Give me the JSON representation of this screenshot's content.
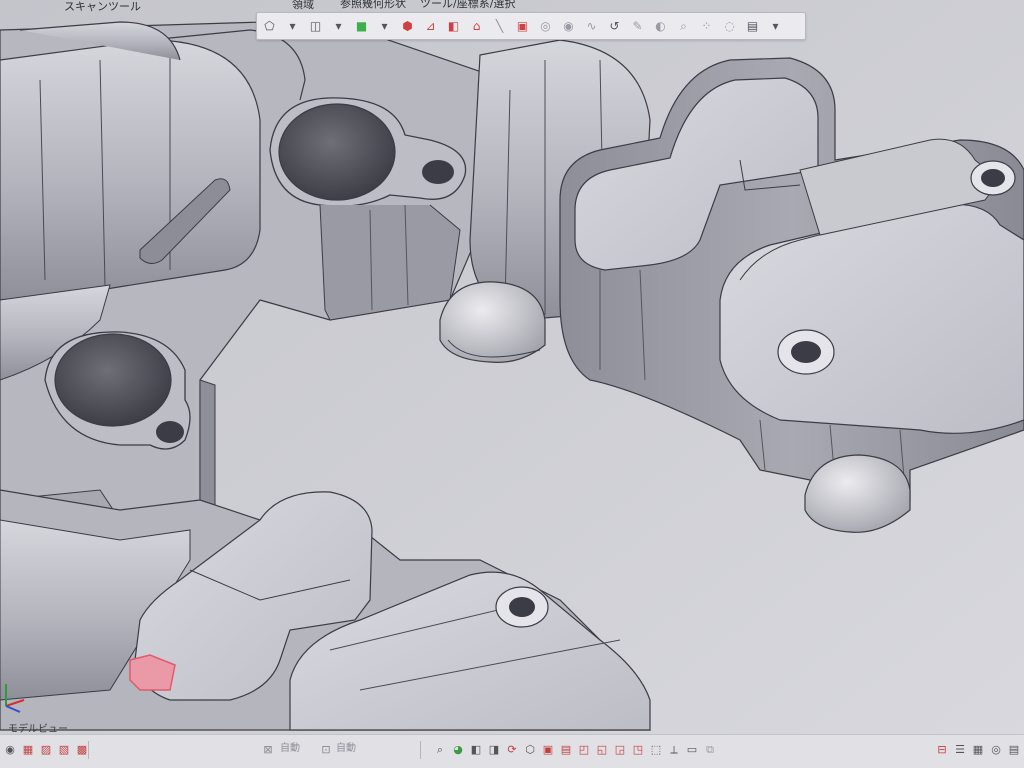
{
  "ribbon": {
    "tab_scan_tools": "スキャンツール",
    "group_area": "領域",
    "group_reference": "参照幾何形状",
    "group_tools": "ツール/座標系/選択"
  },
  "toolbar": {
    "icons": [
      {
        "name": "shape-tool-icon",
        "glyph": "⬠",
        "color": "#555560"
      },
      {
        "name": "dropdown-caret-icon",
        "glyph": "▾",
        "color": "#555560"
      },
      {
        "name": "box-tool-icon",
        "glyph": "◫",
        "color": "#555560"
      },
      {
        "name": "dropdown-caret-icon",
        "glyph": "▾",
        "color": "#555560"
      },
      {
        "name": "color-map-icon",
        "glyph": "■",
        "color": "#3fae4b"
      },
      {
        "name": "dropdown-caret-icon",
        "glyph": "▾",
        "color": "#555560"
      },
      {
        "name": "cube-view-icon",
        "glyph": "⬢",
        "color": "#d04040"
      },
      {
        "name": "plane-view-icon",
        "glyph": "⊿",
        "color": "#d04040"
      },
      {
        "name": "split-view-icon",
        "glyph": "◧",
        "color": "#d04040"
      },
      {
        "name": "section-icon",
        "glyph": "⌂",
        "color": "#d04040"
      },
      {
        "name": "line-tool-icon",
        "glyph": "╲",
        "color": "#8a8a94"
      },
      {
        "name": "select-box-icon",
        "glyph": "▣",
        "color": "#d04040"
      },
      {
        "name": "point-tool-icon",
        "glyph": "◎",
        "color": "#9a9aa4"
      },
      {
        "name": "target-tool-icon",
        "glyph": "◉",
        "color": "#9a9aa4"
      },
      {
        "name": "curve-tool-icon",
        "glyph": "∿",
        "color": "#9a9aa4"
      },
      {
        "name": "lasso-select-icon",
        "glyph": "↺",
        "color": "#555560"
      },
      {
        "name": "brush-select-icon",
        "glyph": "✎",
        "color": "#9a9aa4"
      },
      {
        "name": "sphere-select-icon",
        "glyph": "◐",
        "color": "#9a9aa4"
      },
      {
        "name": "magnify-select-icon",
        "glyph": "⌕",
        "color": "#9a9aa4"
      },
      {
        "name": "dots-tool-icon",
        "glyph": "⁘",
        "color": "#9a9aa4"
      },
      {
        "name": "eye-view-icon",
        "glyph": "◌",
        "color": "#9a9aa4"
      },
      {
        "name": "settings-tool-icon",
        "glyph": "▤",
        "color": "#555560"
      },
      {
        "name": "dropdown-caret-icon",
        "glyph": "▾",
        "color": "#555560"
      }
    ]
  },
  "model_view_label": "モデルビュー",
  "statusbar": {
    "left_icons": [
      {
        "name": "eye-icon",
        "glyph": "◉",
        "color": "#555"
      },
      {
        "name": "select-mode-icon",
        "glyph": "▦",
        "color": "#c04040"
      },
      {
        "name": "select-face-icon",
        "glyph": "▨",
        "color": "#c04040"
      },
      {
        "name": "select-body-icon",
        "glyph": "▧",
        "color": "#c04040"
      },
      {
        "name": "select-all-icon",
        "glyph": "▩",
        "color": "#c04040"
      }
    ],
    "auto_label_1": "自動",
    "auto_label_2": "自動",
    "center_icons": [
      {
        "name": "zoom-view-icon",
        "glyph": "⌕",
        "color": "#555"
      },
      {
        "name": "color-view-icon",
        "glyph": "◕",
        "color": "#3a9a45"
      },
      {
        "name": "front-view-icon",
        "glyph": "◧",
        "color": "#555"
      },
      {
        "name": "back-view-icon",
        "glyph": "◨",
        "color": "#555"
      },
      {
        "name": "rotate-view-icon",
        "glyph": "⟳",
        "color": "#c04040"
      },
      {
        "name": "iso-view-icon",
        "glyph": "⬡",
        "color": "#555"
      },
      {
        "name": "section-view-icon",
        "glyph": "▣",
        "color": "#c04040"
      },
      {
        "name": "box-view-icon",
        "glyph": "▤",
        "color": "#c04040"
      },
      {
        "name": "top-view-icon",
        "glyph": "◰",
        "color": "#c04040"
      },
      {
        "name": "side-view-icon",
        "glyph": "◱",
        "color": "#c04040"
      },
      {
        "name": "bottom-view-icon",
        "glyph": "◲",
        "color": "#c04040"
      },
      {
        "name": "fit-view-icon",
        "glyph": "◳",
        "color": "#c04040"
      },
      {
        "name": "normal-view-icon",
        "glyph": "⬚",
        "color": "#555"
      },
      {
        "name": "measure-icon",
        "glyph": "⟂",
        "color": "#555"
      },
      {
        "name": "transparency-icon",
        "glyph": "▭",
        "color": "#555"
      },
      {
        "name": "copy-view-icon",
        "glyph": "⧉",
        "color": "#9a9aa4"
      }
    ],
    "right_icons": [
      {
        "name": "snap-icon",
        "glyph": "⊟",
        "color": "#c04040"
      },
      {
        "name": "layer-icon",
        "glyph": "☰",
        "color": "#555"
      },
      {
        "name": "grid-icon",
        "glyph": "▦",
        "color": "#555"
      },
      {
        "name": "camera-icon",
        "glyph": "◎",
        "color": "#555"
      },
      {
        "name": "display-settings-icon",
        "glyph": "▤",
        "color": "#555"
      }
    ]
  },
  "colors": {
    "viewport_background": "#d2d1d7",
    "model_surface": "#c3c3cb",
    "model_shadow": "#9e9ea8",
    "edge_lines": "#3c3c46",
    "selection_highlight": "#e05a6a"
  }
}
